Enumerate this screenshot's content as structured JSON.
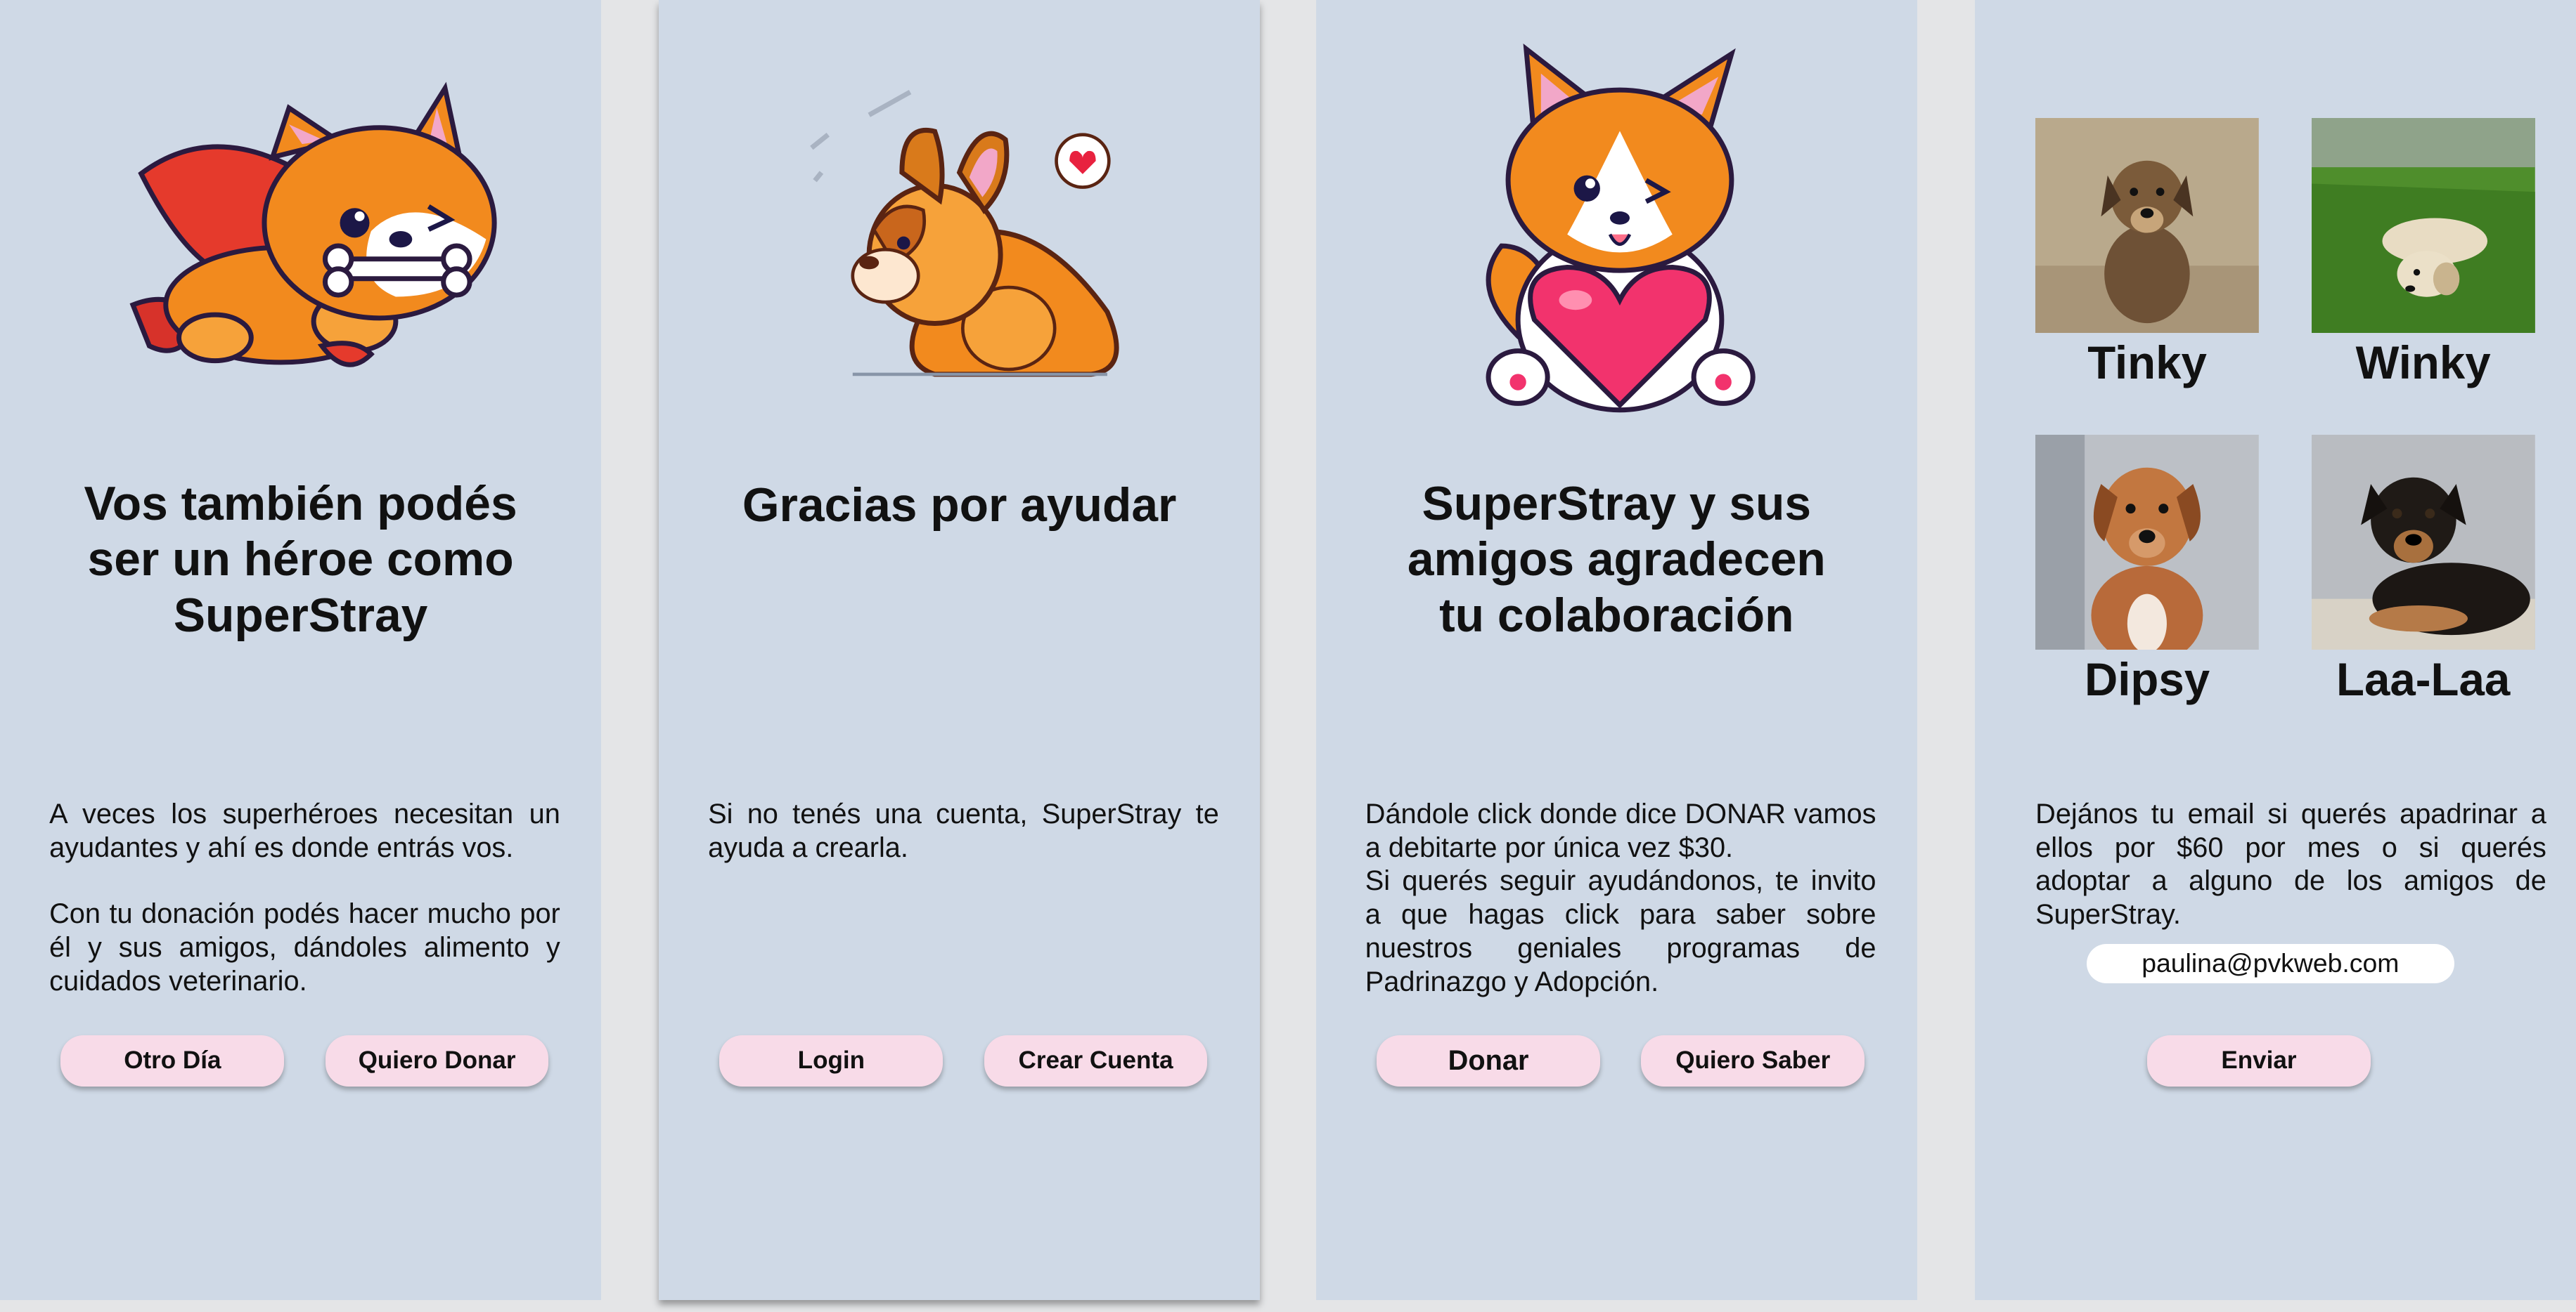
{
  "panels": [
    {
      "title": "Vos también podés ser un héroe como SuperStray",
      "paragraphs": [
        "A veces los superhéroes necesitan un ayudantes y ahí es donde entrás vos.",
        "Con tu donación podés hacer mucho por él y sus amigos, dándoles alimento y cuidados veterinario."
      ],
      "buttons": [
        "Otro Día",
        "Quiero Donar"
      ]
    },
    {
      "title": "Gracias por ayudar",
      "paragraphs": [
        "Si no tenés una cuenta, SuperStray te ayuda a crearla."
      ],
      "buttons": [
        "Login",
        "Crear Cuenta"
      ]
    },
    {
      "title": "SuperStray y sus amigos agradecen tu colaboración",
      "paragraphs": [
        "Dándole click donde dice DONAR vamos a debitarte por única vez $30.",
        "Si querés seguir ayudándonos, te invito a que hagas click para saber sobre nuestros geniales programas de Padrinazgo y Adopción."
      ],
      "buttons": [
        "Donar",
        "Quiero Saber"
      ]
    },
    {
      "dogs": [
        "Tinky",
        "Winky",
        "Dipsy",
        "Laa-Laa"
      ],
      "paragraphs": [
        "Dejános tu email si querés apadrinar a ellos por $60 por mes o si querés adoptar a alguno de los amigos de SuperStray."
      ],
      "email_value": "paulina@pvkweb.com",
      "buttons": [
        "Enviar"
      ]
    }
  ],
  "colors": {
    "panel_bg": "#cfd9e6",
    "button_bg": "#f8dbe8",
    "page_bg": "#e4e5e7"
  },
  "icons": [
    "superhero-dog-icon",
    "french-bulldog-icon",
    "corgi-heart-icon"
  ]
}
